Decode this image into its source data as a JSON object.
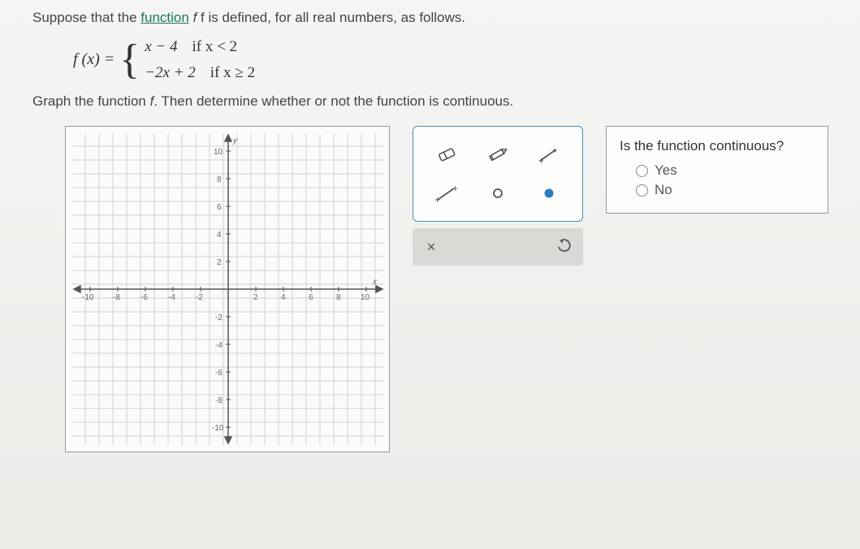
{
  "prompt": {
    "intro_pre": "Suppose that the ",
    "intro_link": "function",
    "intro_post": " f is defined, for all real numbers, as follows."
  },
  "function": {
    "lhs": "f (x) =",
    "case1_expr": "x − 4",
    "case1_cond": "if x < 2",
    "case2_expr": "−2x + 2",
    "case2_cond": "if x ≥ 2"
  },
  "instruction": "Graph the function f. Then determine whether or not the function is continuous.",
  "graph": {
    "axis_label_x": "x",
    "axis_label_y": "y",
    "ticks_pos": [
      2,
      4,
      6,
      8,
      10
    ],
    "ticks_neg": [
      -2,
      -4,
      -6,
      -8,
      -10
    ]
  },
  "tools": {
    "eraser": "eraser-icon",
    "pencil": "pencil-icon",
    "ray": "ray-icon",
    "segment": "segment-icon",
    "open_point": "open-point-icon",
    "closed_point": "closed-point-icon",
    "clear_label": "×",
    "undo_label": "↺"
  },
  "question": {
    "title": "Is the function continuous?",
    "opt_yes": "Yes",
    "opt_no": "No"
  }
}
